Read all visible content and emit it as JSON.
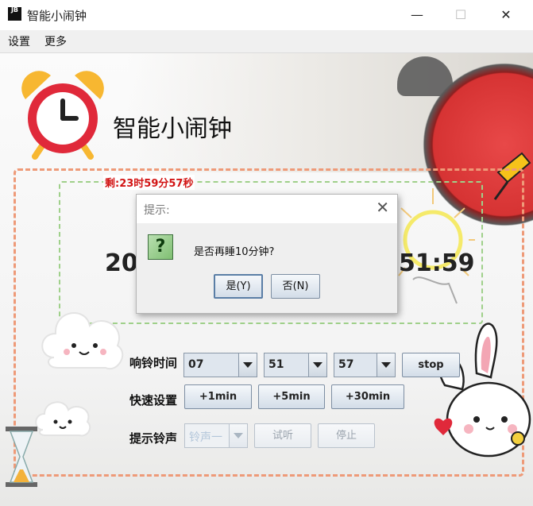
{
  "window": {
    "app_icon_text": "JB",
    "title": "智能小闹钟",
    "controls": {
      "minimize": "—",
      "maximize": "☐",
      "close": "✕"
    }
  },
  "menubar": {
    "items": [
      "设置",
      "更多"
    ]
  },
  "header": {
    "app_title": "智能小闹钟"
  },
  "clock": {
    "remaining": "剩:23时59分57秒",
    "time_left_visible": "20",
    "time_right_visible": "51:59"
  },
  "alarm_row": {
    "label": "响铃时间",
    "hour": "07",
    "minute": "51",
    "second": "57",
    "stop_label": "stop"
  },
  "quick_row": {
    "label": "快速设置",
    "buttons": [
      "+1min",
      "+5min",
      "+30min"
    ]
  },
  "ringtone_row": {
    "label": "提示铃声",
    "select_value": "铃声一",
    "try_label": "试听",
    "stop_label": "停止"
  },
  "dialog": {
    "title": "提示:",
    "close": "✕",
    "icon_glyph": "?",
    "message": "是否再睡10分钟?",
    "yes_label": "是(Y)",
    "no_label": "否(N)"
  },
  "colors": {
    "outer_dash": "#ee9a78",
    "inner_dash": "#9fd08a",
    "remaining_text": "#d21414",
    "alarm_clock_red": "#e0293a"
  }
}
